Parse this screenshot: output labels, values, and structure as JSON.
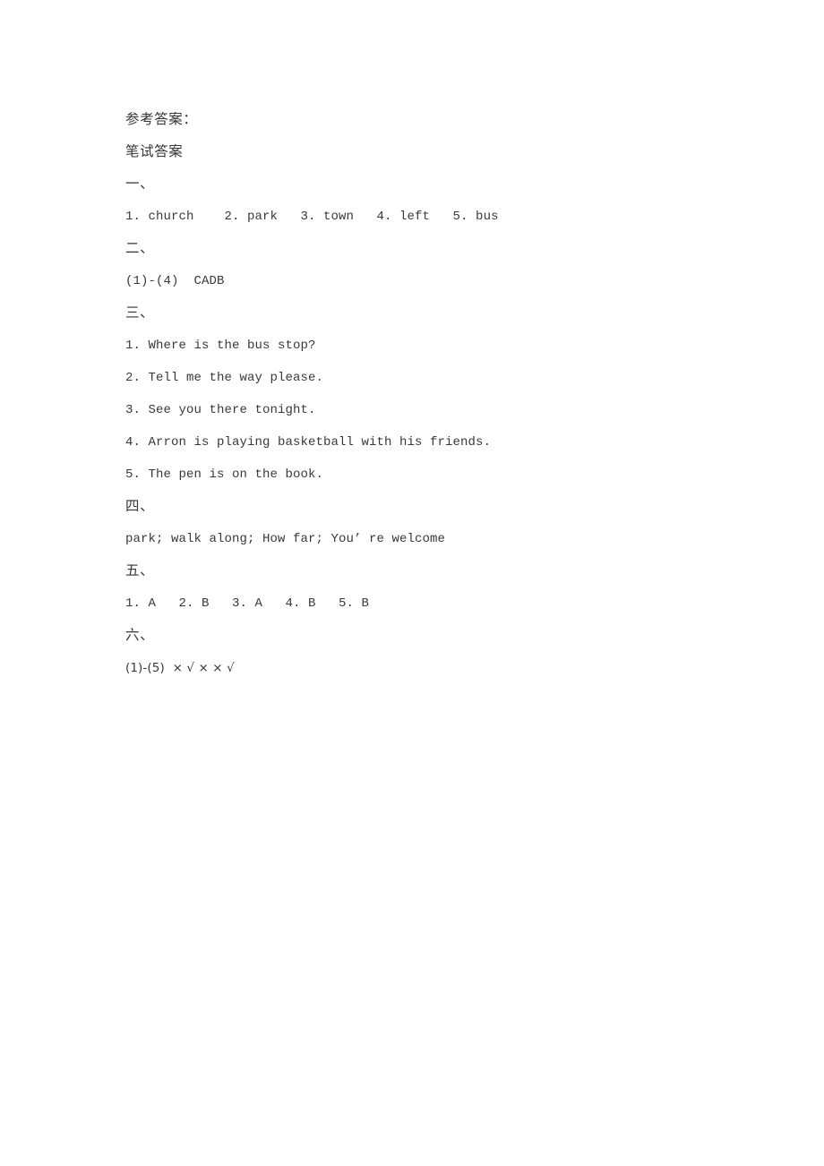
{
  "document": {
    "title_label": "参考答案：",
    "subtitle_label": "笔试答案",
    "sections": [
      {
        "heading": "一、",
        "lines": [
          "1. church    2. park   3. town   4. left   5. bus"
        ]
      },
      {
        "heading": "二、",
        "lines": [
          "(1)-(4)  CADB"
        ]
      },
      {
        "heading": "三、",
        "lines": [
          "1. Where is the bus stop?",
          "2. Tell me the way please.",
          "3. See you there tonight.",
          "4. Arron is playing basketball with his friends.",
          "5. The pen is on the book."
        ]
      },
      {
        "heading": "四、",
        "lines": [
          "park; walk along; How far; You’ re welcome"
        ]
      },
      {
        "heading": "五、",
        "lines": [
          "1. A   2. B   3. A   4. B   5. B"
        ]
      },
      {
        "heading": "六、",
        "lines": [
          "(1)-(5)  × √ × × √"
        ]
      }
    ],
    "text_color": "#393939",
    "background_color": "#ffffff"
  }
}
